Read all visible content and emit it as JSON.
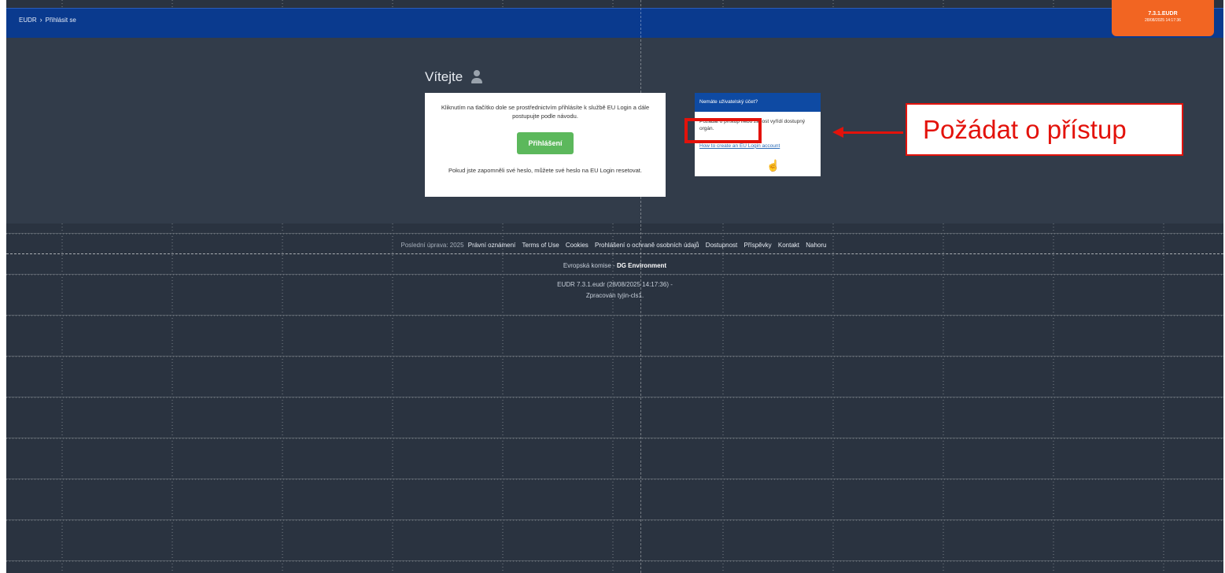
{
  "breadcrumb": {
    "root": "EUDR",
    "separator": "›",
    "current": "Přihlásit se"
  },
  "badge": {
    "version": "7.3.1.EUDR",
    "timestamp": "28/08/2025 14:17:36"
  },
  "welcome": {
    "title": "Vítejte",
    "icon": "user-icon"
  },
  "login_card": {
    "instructions": "Kliknutím na tlačítko dole se prostřednictvím přihlásíte k službě EU Login a dále postupujte podle návodu.",
    "button_label": "Přihlášení",
    "reset_text": "Pokud jste zapomněli své heslo, můžete své heslo na EU Login resetovat."
  },
  "account_card": {
    "header": "Nemáte uživatelský účet?",
    "request_link": "Požádat o přístup",
    "request_suffix": "nebo žádost vyřídí dostupný orgán.",
    "howto_link": "How to create an EU Login account"
  },
  "callout": {
    "text": "Požádat o přístup",
    "color": "#e3120b"
  },
  "footer": {
    "last_update": "Poslední úprava: 2025",
    "links": [
      "Právní oznámení",
      "Terms of Use",
      "Cookies",
      "Prohlášení o ochraně osobních údajů",
      "Dostupnost",
      "Příspěvky",
      "Kontakt",
      "Nahoru"
    ],
    "org_prefix": "Evropská komise -",
    "org_name": "DG Environment",
    "build": "EUDR 7.3.1.eudr (28/08/2025 14:17:36) -",
    "processed_by": "Zpracován tyjin-cls1."
  }
}
